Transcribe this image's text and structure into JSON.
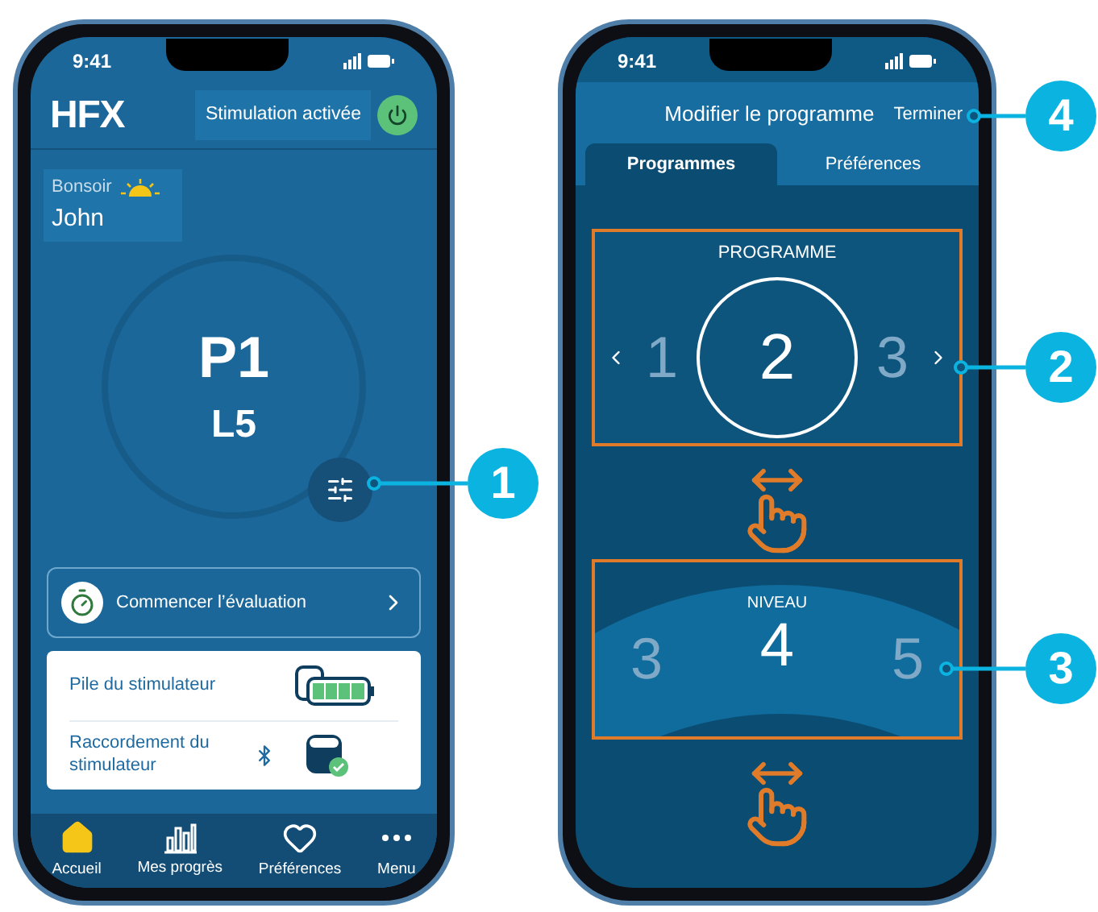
{
  "left_phone": {
    "status_time": "9:41",
    "logo": "HFX",
    "stimulation_status": "Stimulation activée",
    "power_on": true,
    "greeting": "Bonsoir",
    "user_name": "John",
    "program": "P1",
    "level": "L5",
    "evaluation_button": "Commencer l’évaluation",
    "status_rows": [
      {
        "kind": "battery",
        "label": "Pile du stimulateur"
      },
      {
        "kind": "connection",
        "label": "Raccordement du stimulateur"
      }
    ],
    "nav": [
      {
        "label": "Accueil",
        "selected": true
      },
      {
        "label": "Mes progrès",
        "selected": false
      },
      {
        "label": "Préférences",
        "selected": false
      },
      {
        "label": "Menu",
        "selected": false
      }
    ]
  },
  "right_phone": {
    "status_time": "9:41",
    "title": "Modifier le programme",
    "done_button": "Terminer",
    "tabs": [
      {
        "label": "Programmes",
        "selected": true
      },
      {
        "label": "Préférences",
        "selected": false
      }
    ],
    "program_picker": {
      "title": "PROGRAMME",
      "options": [
        {
          "label": "1",
          "selected": false
        },
        {
          "label": "2",
          "selected": true
        },
        {
          "label": "3",
          "selected": false
        }
      ]
    },
    "level_picker": {
      "title": "NIVEAU",
      "options": [
        {
          "label": "3",
          "selected": false
        },
        {
          "label": "4",
          "selected": true
        },
        {
          "label": "5",
          "selected": false
        }
      ]
    }
  },
  "callouts": [
    {
      "number": "4"
    },
    {
      "number": "2"
    },
    {
      "number": "1"
    },
    {
      "number": "3"
    }
  ]
}
